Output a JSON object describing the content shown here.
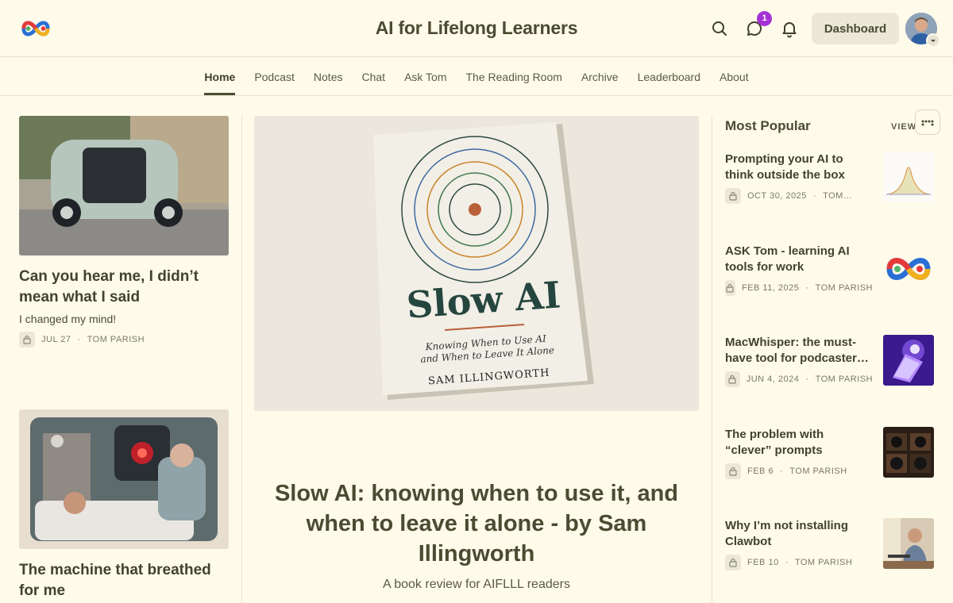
{
  "header": {
    "site_title": "AI for Lifelong Learners",
    "notification_count": "1",
    "dashboard_label": "Dashboard"
  },
  "nav": {
    "items": [
      "Home",
      "Podcast",
      "Notes",
      "Chat",
      "Ask Tom",
      "The Reading Room",
      "Archive",
      "Leaderboard",
      "About"
    ],
    "active": "Home"
  },
  "left_posts": [
    {
      "title": "Can you hear me, I didn’t mean what I said",
      "subtitle": "I changed my mind!",
      "date": "JUL 27",
      "author": "TOM PARISH",
      "image": "autonomous-shuttle-photo"
    },
    {
      "title": "The machine that breathed for me",
      "image": "hospital-machine-illustration"
    }
  ],
  "featured": {
    "title": "Slow AI: knowing when to use it, and when to leave it alone - by Sam Illingworth",
    "subtitle": "A book review for AIFLLL readers",
    "book": {
      "title": "Slow AI",
      "subtitle_line1": "Knowing When to Use AI",
      "subtitle_line2": "and When to Leave It Alone",
      "author": "SAM ILLINGWORTH"
    }
  },
  "popular": {
    "heading": "Most Popular",
    "view_all": "VIEW ALL",
    "items": [
      {
        "title": "Prompting your AI to think outside the box",
        "date": "OCT 30, 2025",
        "author": "TOM…",
        "thumb": "bell-curve-chart-thumb"
      },
      {
        "title": "ASK Tom - learning AI tools for work",
        "date": "FEB 11, 2025",
        "author": "TOM PARISH",
        "thumb": "aifll-logo-thumb"
      },
      {
        "title": "MacWhisper: the must-have tool for podcaster…",
        "date": "JUN 4, 2024",
        "author": "TOM PARISH",
        "thumb": "glowing-laptop-thumb"
      },
      {
        "title": "The problem with “clever” prompts",
        "date": "FEB 6",
        "author": "TOM PARISH",
        "thumb": "vintage-cameras-thumb"
      },
      {
        "title": "Why I’m not installing Clawbot",
        "date": "FEB 10",
        "author": "TOM PARISH",
        "thumb": "man-at-laptop-thumb"
      }
    ]
  },
  "colors": {
    "background": "#fefbea",
    "text": "#4b4b33",
    "badge": "#a531d6"
  }
}
